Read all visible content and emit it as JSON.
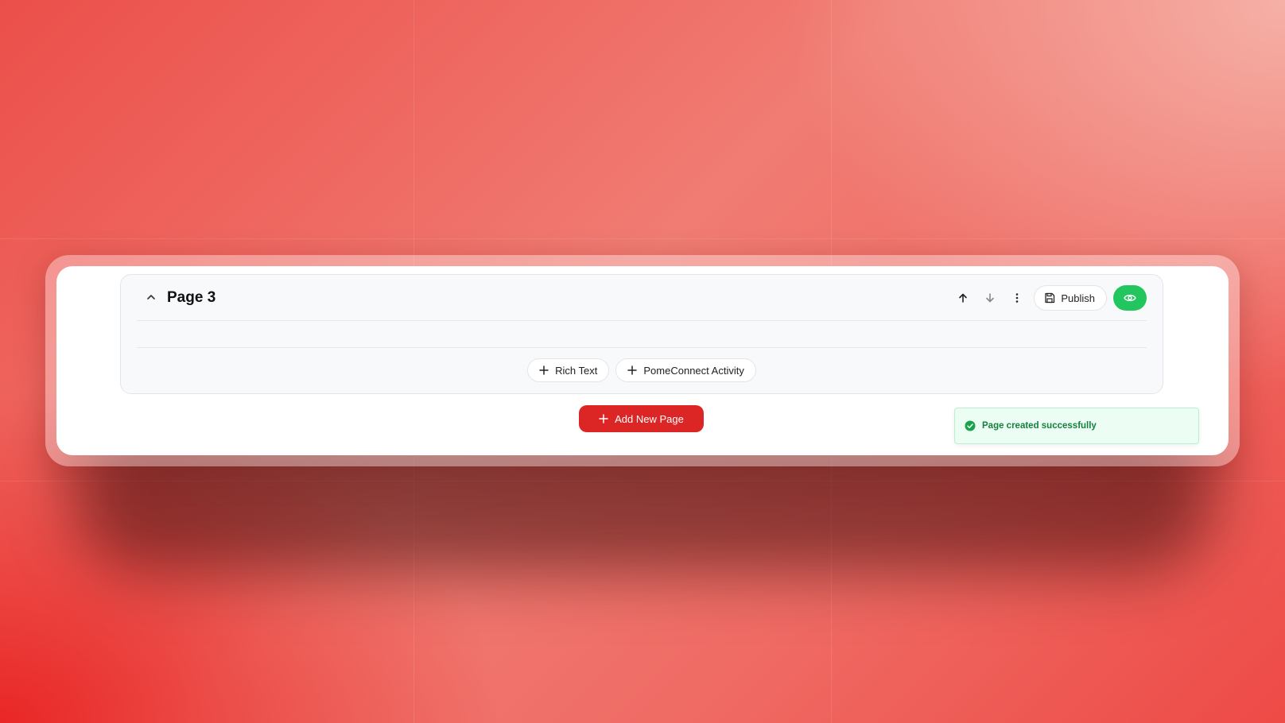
{
  "page_card": {
    "title": "Page 3",
    "publish_label": "Publish"
  },
  "blocks": {
    "rich_text_label": "Rich Text",
    "activity_label": "PomeConnect Activity"
  },
  "add_page_label": "Add New Page",
  "toast": {
    "message": "Page created successfully"
  },
  "icons": {
    "collapse": "chevron-up-icon",
    "move_up": "arrow-up-icon",
    "move_down": "arrow-down-icon",
    "more": "more-vertical-icon",
    "publish": "save-icon",
    "preview": "eye-icon",
    "add": "plus-icon",
    "toast": "check-circle-icon"
  },
  "colors": {
    "primary_red": "#dc2626",
    "success_green": "#22c55e",
    "toast_text": "#15803d"
  }
}
